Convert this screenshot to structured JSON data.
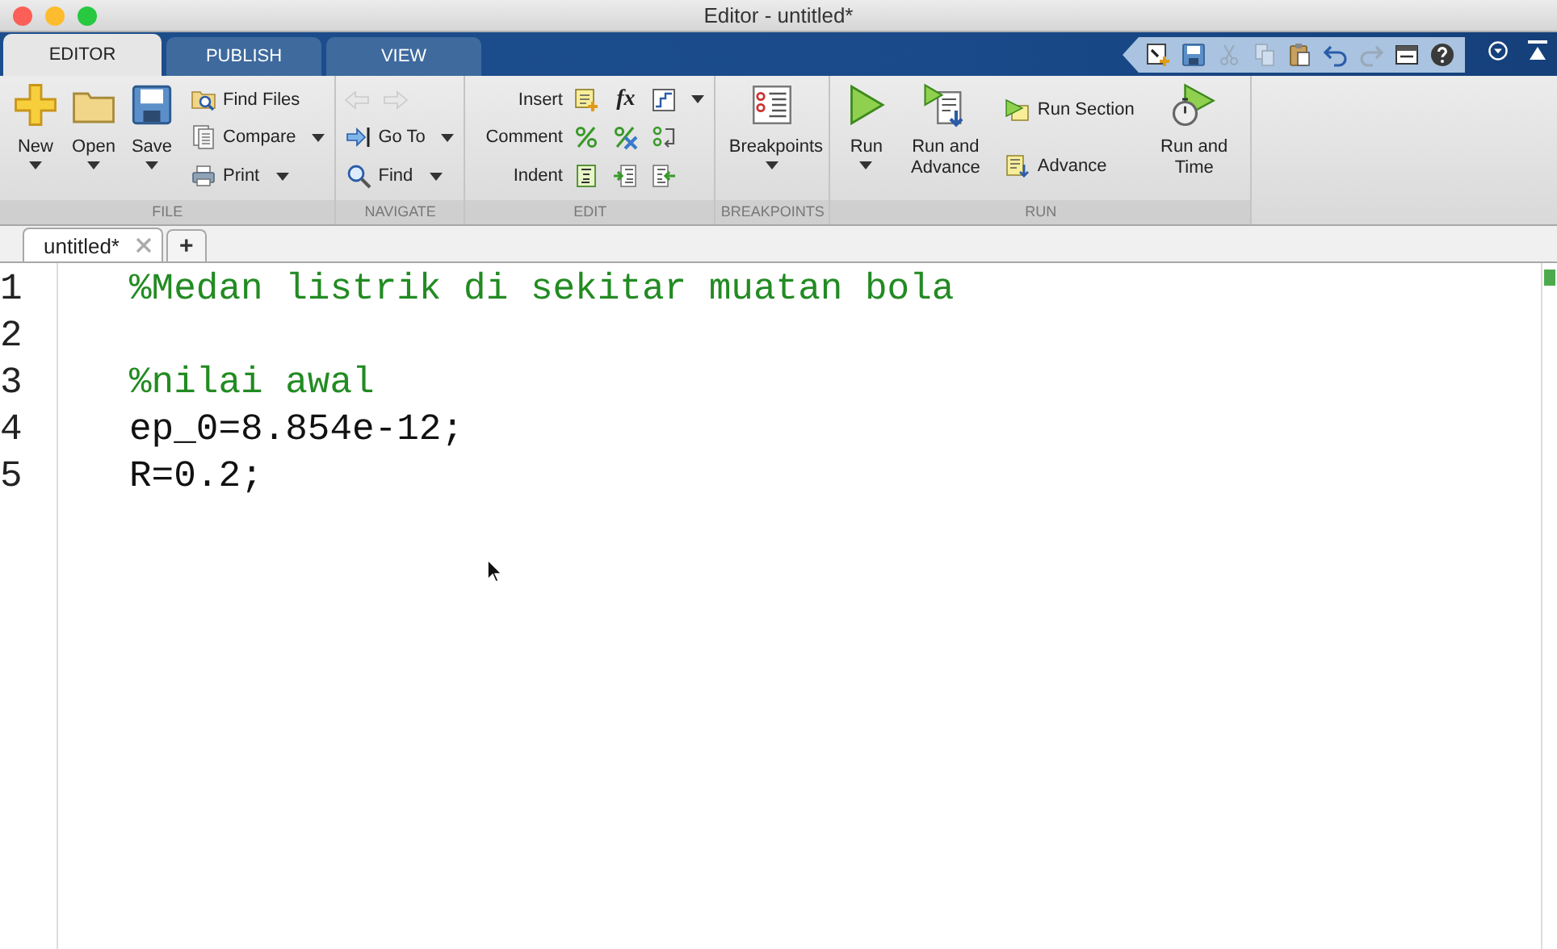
{
  "window": {
    "title": "Editor - untitled*"
  },
  "tabs": [
    {
      "label": "EDITOR",
      "selected": true
    },
    {
      "label": "PUBLISH",
      "selected": false
    },
    {
      "label": "VIEW",
      "selected": false
    }
  ],
  "quick_access": [
    {
      "kind": "newdoc",
      "disabled": false
    },
    {
      "kind": "save",
      "disabled": false
    },
    {
      "kind": "cut",
      "disabled": true
    },
    {
      "kind": "copy",
      "disabled": true
    },
    {
      "kind": "paste",
      "disabled": false
    },
    {
      "kind": "undo",
      "disabled": false
    },
    {
      "kind": "redo",
      "disabled": true
    },
    {
      "kind": "windows",
      "disabled": false
    },
    {
      "kind": "help",
      "disabled": false
    }
  ],
  "sections": [
    {
      "title": "FILE",
      "columns": [
        {
          "kind": "large",
          "items": [
            {
              "kind": "new",
              "label": "New",
              "dropdown": true
            },
            {
              "kind": "open",
              "label": "Open",
              "dropdown": true
            },
            {
              "kind": "save",
              "label": "Save",
              "dropdown": true
            }
          ]
        },
        {
          "kind": "stack",
          "items": [
            {
              "kind": "findfiles",
              "label": "Find Files",
              "dropdown": false
            },
            {
              "kind": "compare",
              "label": "Compare",
              "dropdown": true
            },
            {
              "kind": "print",
              "label": "Print",
              "dropdown": true
            }
          ]
        }
      ]
    },
    {
      "title": "NAVIGATE",
      "columns": [
        {
          "kind": "stack",
          "items": [
            {
              "icons": [
                {
                  "kind": "back",
                  "disabled": true
                },
                {
                  "kind": "forward",
                  "disabled": true
                }
              ],
              "dropdown": false
            },
            {
              "kind": "goto",
              "label": "Go To",
              "dropdown": true
            },
            {
              "kind": "find",
              "label": "Find",
              "dropdown": true
            }
          ]
        }
      ]
    },
    {
      "title": "EDIT",
      "columns": [
        {
          "kind": "stack",
          "items": [
            {
              "label": "Insert",
              "icons": [
                {
                  "kind": "insert",
                  "disabled": false
                },
                {
                  "kind": "fx",
                  "glyph": "fx",
                  "disabled": false
                },
                {
                  "kind": "fi",
                  "disabled": false
                }
              ],
              "dropdown": true
            },
            {
              "label": "Comment",
              "icons": [
                {
                  "kind": "comment",
                  "disabled": false
                },
                {
                  "kind": "uncomment",
                  "disabled": false
                },
                {
                  "kind": "wrap",
                  "disabled": false
                }
              ],
              "dropdown": false
            },
            {
              "label": "Indent",
              "icons": [
                {
                  "kind": "smartindent",
                  "disabled": false
                },
                {
                  "kind": "indent",
                  "disabled": false
                },
                {
                  "kind": "outdent",
                  "disabled": false
                }
              ],
              "dropdown": false
            }
          ]
        }
      ]
    },
    {
      "title": "BREAKPOINTS",
      "columns": [
        {
          "kind": "large",
          "items": [
            {
              "kind": "breakpoints",
              "label": "Breakpoints",
              "dropdown": true
            }
          ]
        }
      ]
    },
    {
      "title": "RUN",
      "columns": [
        {
          "kind": "large",
          "items": [
            {
              "kind": "run",
              "label": "Run",
              "dropdown": true
            },
            {
              "kind": "runadvance",
              "label": "Run and Advance",
              "dropdown": false
            }
          ]
        },
        {
          "kind": "stack",
          "items": [
            {
              "kind": "runsection",
              "label": "Run Section",
              "dropdown": false
            },
            {
              "kind": "advance",
              "label": "Advance",
              "dropdown": false
            }
          ]
        },
        {
          "kind": "large",
          "items": [
            {
              "kind": "runtime",
              "label": "Run and Time",
              "dropdown": false
            }
          ]
        }
      ]
    }
  ],
  "editor_tabs": [
    {
      "label": "untitled*",
      "selected": true
    }
  ],
  "new_tab_label": "+",
  "code_lines": [
    {
      "number": "1",
      "kind": "comment",
      "text": "%Medan listrik di sekitar muatan bola"
    },
    {
      "number": "2"
    },
    {
      "number": "3",
      "kind": "comment",
      "text": "%nilai awal"
    },
    {
      "number": "4",
      "kind": "code",
      "text": "ep_0=8.854e-12;"
    },
    {
      "number": "5",
      "kind": "code",
      "text": "R=0.2;"
    }
  ]
}
